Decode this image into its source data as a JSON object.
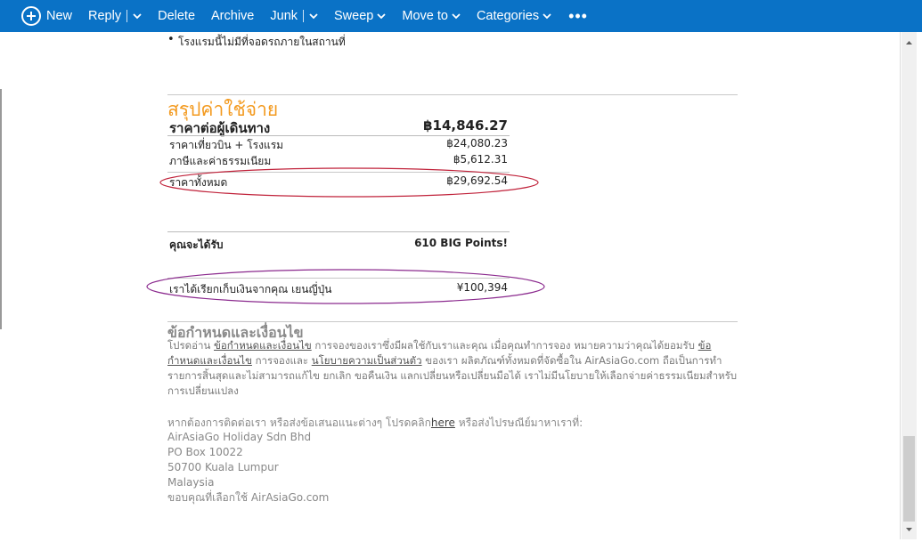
{
  "toolbar": {
    "new": "New",
    "reply": "Reply",
    "delete": "Delete",
    "archive": "Archive",
    "junk": "Junk",
    "sweep": "Sweep",
    "move_to": "Move to",
    "categories": "Categories",
    "more": "•••"
  },
  "email": {
    "bullet": "โรงแรมนี้ไม่มีที่จอดรถภายในสถานที่",
    "summary": {
      "title": "สรุปค่าใช้จ่าย",
      "per_person_label": "ราคาต่อผู้เดินทาง",
      "per_person_value": "฿14,846.27",
      "flight_hotel_label": "ราคาเที่ยวบิน + โรงแรม",
      "flight_hotel_value": "฿24,080.23",
      "taxes_label": "ภาษีและค่าธรรมเนียม",
      "taxes_value": "฿5,612.31",
      "total_label": "ราคาทั้งหมด",
      "total_value": "฿29,692.54",
      "earn_label": "คุณจะได้รับ",
      "earn_value": "610 BIG Points!",
      "charged_label": "เราได้เรียกเก็บเงินจากคุณ เยนญี่ปุ่น",
      "charged_value": "¥100,394"
    },
    "terms": {
      "title": "ข้อกำหนดและเงื่อนไข",
      "p1": "โปรดอ่าน ",
      "link1": "ข้อกำหนดและเงื่อนไข",
      "p2": " การจองของเราซึ่งมีผลใช้กับเราและคุณ เมื่อคุณทำการจอง หมายความว่าคุณได้ยอมรับ ",
      "link2": "ข้อกำหนดและเงื่อนไข",
      "p3": " การจองและ ",
      "link3": "นโยบายความเป็นส่วนตัว",
      "p4": " ของเรา ผลิตภัณฑ์ทั้งหมดที่จัดซื้อใน AirAsiaGo.com ถือเป็นการทำรายการสิ้นสุดและไม่สามารถแก้ไข ยกเลิก ขอคืนเงิน แลกเปลี่ยนหรือเปลี่ยนมือได้ เราไม่มีนโยบายให้เลือกจ่ายค่าธรรมเนียมสำหรับการเปลี่ยนแปลง"
    },
    "contact": {
      "intro_a": "หากต้องการติดต่อเรา หรือส่งข้อเสนอแนะต่างๆ โปรดคลิก",
      "intro_link": "here",
      "intro_b": " หรือส่งไปรษณีย์มาหาเราที่:",
      "company": "AirAsiaGo Holiday Sdn Bhd",
      "po_box": "PO Box 10022",
      "city": "50700 Kuala Lumpur",
      "country": "Malaysia",
      "thanks": "ขอบคุณที่เลือกใช้ AirAsiaGo.com"
    }
  },
  "colors": {
    "toolbar_bg": "#0a72c6",
    "summary_title": "#f39a1f",
    "ellipse_total": "#c0223a",
    "ellipse_charged": "#8b2a8e"
  }
}
